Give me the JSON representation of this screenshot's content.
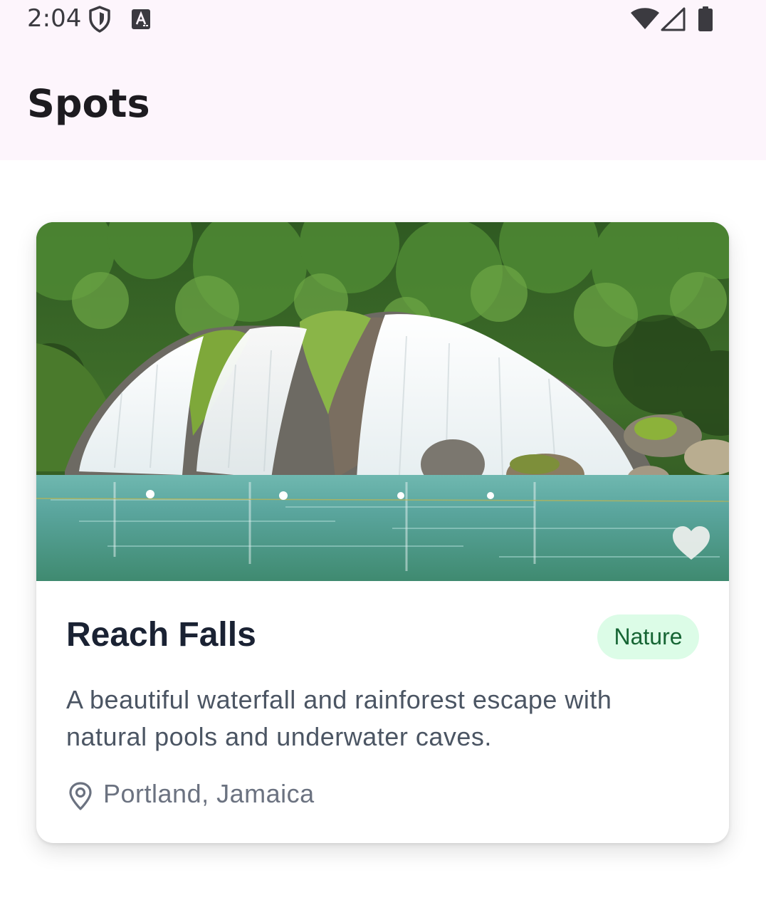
{
  "status_bar": {
    "time": "2:04",
    "icons": [
      "shield-icon",
      "a-badge-icon",
      "wifi-icon",
      "signal-icon",
      "battery-icon"
    ]
  },
  "app_bar": {
    "title": "Spots"
  },
  "spots": [
    {
      "name": "Reach Falls",
      "category": "Nature",
      "description": "A beautiful waterfall and rainforest escape with natural pools and underwater caves.",
      "location": "Portland, Jamaica",
      "image_subject": "waterfall cascading over rocks into a turquoise pool surrounded by rainforest",
      "favorite_icon": "heart-icon",
      "favorited": false,
      "location_icon": "location-pin-icon"
    }
  ],
  "colors": {
    "app_bar_bg": "#fdf5fc",
    "title_text": "#1a2233",
    "badge_bg": "#dcfce7",
    "badge_text": "#166534",
    "body_text": "#4b5563",
    "muted_text": "#6b7280"
  }
}
